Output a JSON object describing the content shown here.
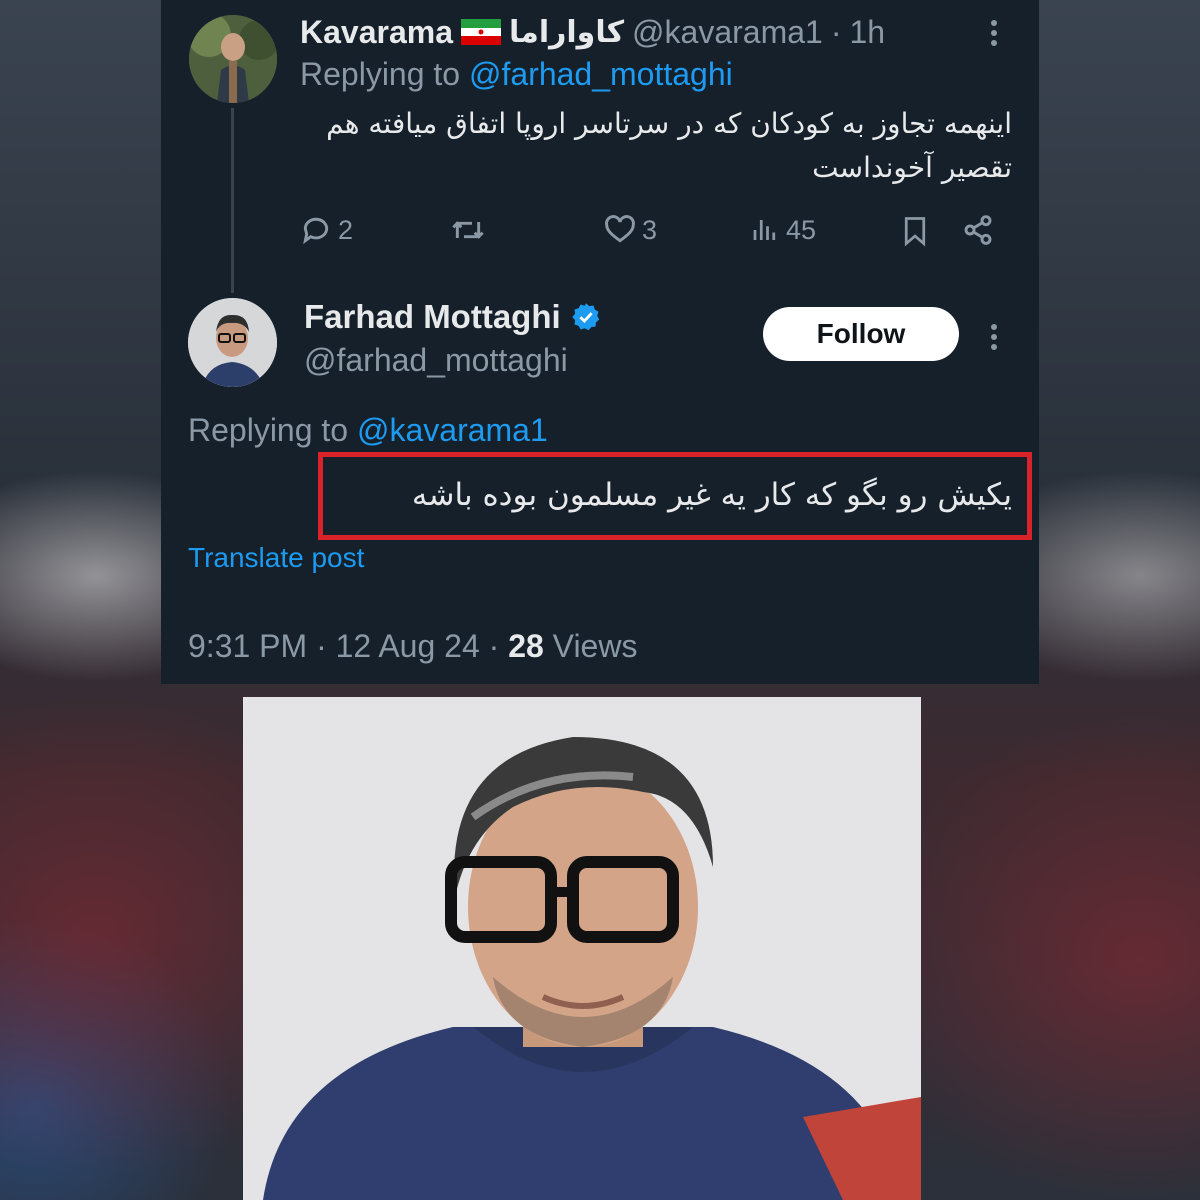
{
  "reply_tweet": {
    "display_name": "Kavarama",
    "flag_icon": "iran-flag-icon",
    "rtl_name": "کاواراما",
    "handle": "@kavarama1",
    "separator": "·",
    "time": "1h",
    "replying_prefix": "Replying to",
    "replying_handle": "@farhad_mottaghi",
    "text_line1": "اینهمه تجاوز به کودکان که در سرتاسر اروپا اتفاق میافته هم",
    "text_line2": "تقصیر آخونداست",
    "actions": {
      "replies": "2",
      "retweets": "",
      "likes": "3",
      "views": "45"
    }
  },
  "main_tweet": {
    "display_name": "Farhad Mottaghi",
    "verified_icon": "verified-badge-icon",
    "handle": "@farhad_mottaghi",
    "follow_label": "Follow",
    "replying_prefix": "Replying to",
    "replying_handle": "@kavarama1",
    "text": "یکیش رو بگو که کار یه غیر مسلمون بوده باشه",
    "translate_label": "Translate post",
    "time": "9:31 PM",
    "sep1": "·",
    "date": "12 Aug 24",
    "sep2": "·",
    "views_count": "28",
    "views_label": "Views"
  },
  "colors": {
    "panel_bg": "#15202b",
    "accent": "#1d9bf0",
    "highlight": "#d8232a",
    "text_primary": "#e7e9ea",
    "text_muted": "#8b98a5"
  }
}
